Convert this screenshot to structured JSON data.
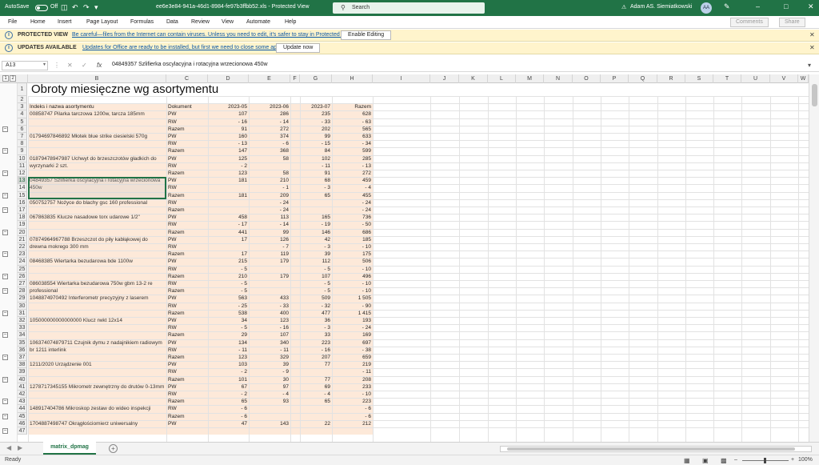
{
  "titlebar": {
    "autosave_label": "AutoSave",
    "autosave_state": "Off",
    "doc_title": "ee6e3e84-941a-46d1-8984-fe97b3ffbb52.xls  -  Protected View",
    "search_placeholder": "Search",
    "user_name": "Adam AS. Siemiatkowski",
    "user_initials": "AA"
  },
  "menu": {
    "items": [
      "File",
      "Home",
      "Insert",
      "Page Layout",
      "Formulas",
      "Data",
      "Review",
      "View",
      "Automate",
      "Help"
    ],
    "comments_label": "Comments",
    "share_label": "Share"
  },
  "protected_bar": {
    "heading": "PROTECTED VIEW",
    "message": "Be careful—files from the Internet can contain viruses. Unless you need to edit, it's safer to stay in Protected View.",
    "button": "Enable Editing"
  },
  "update_bar": {
    "heading": "UPDATES AVAILABLE",
    "message": "Updates for Office are ready to be installed, but first we need to close some apps.",
    "button": "Update now"
  },
  "formula_bar": {
    "name_box": "A13",
    "content": "04849357 Szlifierka oscylacyjna i rotacyjna wrzecionowa 450w"
  },
  "columns": [
    "B",
    "C",
    "D",
    "E",
    "F",
    "G",
    "H",
    "I",
    "J",
    "K",
    "L",
    "M",
    "N",
    "O",
    "P",
    "Q",
    "R",
    "S",
    "T",
    "U",
    "V",
    "W"
  ],
  "selected_cell": "A13",
  "sheet": {
    "title": "Obroty miesięczne wg asortymentu",
    "headers": [
      "Indeks i nazwa asortymentu",
      "Dokument",
      "2023-05",
      "2023-06",
      "2023-07",
      "Razem"
    ],
    "rows": [
      {
        "r": 4,
        "name": "00858747 Pilarka tarczowa 1200w, tarcza 185mm",
        "doc": "PW",
        "v": [
          "107",
          "286",
          "235",
          "628"
        ]
      },
      {
        "r": 5,
        "name": "",
        "doc": "RW",
        "v": [
          "- 16",
          "- 14",
          "- 33",
          "- 63"
        ]
      },
      {
        "r": 6,
        "name": "",
        "doc": "Razem",
        "v": [
          "91",
          "272",
          "202",
          "565"
        ]
      },
      {
        "r": 7,
        "name": "01794697846892 Młotek blue strike ciesielski 570g",
        "doc": "PW",
        "v": [
          "160",
          "374",
          "99",
          "633"
        ]
      },
      {
        "r": 8,
        "name": "",
        "doc": "RW",
        "v": [
          "- 13",
          "- 6",
          "- 15",
          "- 34"
        ]
      },
      {
        "r": 9,
        "name": "",
        "doc": "Razem",
        "v": [
          "147",
          "368",
          "84",
          "599"
        ]
      },
      {
        "r": 10,
        "name": "01879478947987 Uchwyt do brzeszczotów gładkich do wyrzynarki 2 szt.",
        "doc": "PW",
        "v": [
          "125",
          "58",
          "102",
          "285"
        ]
      },
      {
        "r": 11,
        "name": "",
        "doc": "RW",
        "v": [
          "- 2",
          "",
          "- 11",
          "- 13"
        ]
      },
      {
        "r": 12,
        "name": "",
        "doc": "Razem",
        "v": [
          "123",
          "58",
          "91",
          "272"
        ]
      },
      {
        "r": 13,
        "name": "04849357 Szlifierka oscylacyjna i rotacyjna wrzecionowa 450w",
        "doc": "PW",
        "v": [
          "181",
          "210",
          "68",
          "459"
        ]
      },
      {
        "r": 14,
        "name": "",
        "doc": "RW",
        "v": [
          "",
          "- 1",
          "- 3",
          "- 4"
        ]
      },
      {
        "r": 15,
        "name": "",
        "doc": "Razem",
        "v": [
          "181",
          "209",
          "65",
          "455"
        ]
      },
      {
        "r": 16,
        "name": "050752757 Nożyce do blachy gsc 160 professional",
        "doc": "RW",
        "v": [
          "",
          "- 24",
          "",
          "- 24"
        ]
      },
      {
        "r": 17,
        "name": "",
        "doc": "Razem",
        "v": [
          "",
          "- 24",
          "",
          "- 24"
        ]
      },
      {
        "r": 18,
        "name": "067863835 Klucze nasadowe torx udarowe 1/2\"",
        "doc": "PW",
        "v": [
          "458",
          "113",
          "165",
          "736"
        ]
      },
      {
        "r": 19,
        "name": "",
        "doc": "RW",
        "v": [
          "- 17",
          "- 14",
          "- 19",
          "- 50"
        ]
      },
      {
        "r": 20,
        "name": "",
        "doc": "Razem",
        "v": [
          "441",
          "99",
          "146",
          "686"
        ]
      },
      {
        "r": 21,
        "name": "07874964967788 Brzeszczot do piły kabłąkowej do drewna mokrego 300 mm",
        "doc": "PW",
        "v": [
          "17",
          "126",
          "42",
          "185"
        ]
      },
      {
        "r": 22,
        "name": "",
        "doc": "RW",
        "v": [
          "",
          "- 7",
          "- 3",
          "- 10"
        ]
      },
      {
        "r": 23,
        "name": "",
        "doc": "Razem",
        "v": [
          "17",
          "119",
          "39",
          "175"
        ]
      },
      {
        "r": 24,
        "name": "08468385 Wiertarka bezudarowa bde 1100w",
        "doc": "PW",
        "v": [
          "215",
          "179",
          "112",
          "506"
        ]
      },
      {
        "r": 25,
        "name": "",
        "doc": "RW",
        "v": [
          "- 5",
          "",
          "- 5",
          "- 10"
        ]
      },
      {
        "r": 26,
        "name": "",
        "doc": "Razem",
        "v": [
          "210",
          "179",
          "107",
          "496"
        ]
      },
      {
        "r": 27,
        "name": "086038554 Wiertarka bezudarowa 750w gbm 13-2 re professional",
        "doc": "RW",
        "v": [
          "- 5",
          "",
          "- 5",
          "- 10"
        ]
      },
      {
        "r": 28,
        "name": "",
        "doc": "Razem",
        "v": [
          "- 5",
          "",
          "- 5",
          "- 10"
        ]
      },
      {
        "r": 29,
        "name": "1048874970492 Interferometr precyzyjny z laserem",
        "doc": "PW",
        "v": [
          "563",
          "433",
          "509",
          "1 505"
        ]
      },
      {
        "r": 30,
        "name": "",
        "doc": "RW",
        "v": [
          "- 25",
          "- 33",
          "- 32",
          "- 90"
        ]
      },
      {
        "r": 31,
        "name": "",
        "doc": "Razem",
        "v": [
          "538",
          "400",
          "477",
          "1 415"
        ]
      },
      {
        "r": 32,
        "name": "105000000000000000 Klucz rwkt 12x14",
        "doc": "PW",
        "v": [
          "34",
          "123",
          "36",
          "193"
        ]
      },
      {
        "r": 33,
        "name": "",
        "doc": "RW",
        "v": [
          "- 5",
          "- 16",
          "- 3",
          "- 24"
        ]
      },
      {
        "r": 34,
        "name": "",
        "doc": "Razem",
        "v": [
          "29",
          "107",
          "33",
          "169"
        ]
      },
      {
        "r": 35,
        "name": "106374074879711 Czujnik dymu z nadajnikiem radiowym br 1211 interlink",
        "doc": "PW",
        "v": [
          "134",
          "340",
          "223",
          "697"
        ]
      },
      {
        "r": 36,
        "name": "",
        "doc": "RW",
        "v": [
          "- 11",
          "- 11",
          "- 16",
          "- 38"
        ]
      },
      {
        "r": 37,
        "name": "",
        "doc": "Razem",
        "v": [
          "123",
          "329",
          "207",
          "659"
        ]
      },
      {
        "r": 38,
        "name": "1211/2020 Urządzenie 001",
        "doc": "PW",
        "v": [
          "103",
          "39",
          "77",
          "219"
        ]
      },
      {
        "r": 39,
        "name": "",
        "doc": "RW",
        "v": [
          "- 2",
          "- 9",
          "",
          "- 11"
        ]
      },
      {
        "r": 40,
        "name": "",
        "doc": "Razem",
        "v": [
          "101",
          "30",
          "77",
          "208"
        ]
      },
      {
        "r": 41,
        "name": "1278717345155 Mikrometr zewnętrzny do drutów 0-13mm",
        "doc": "PW",
        "v": [
          "67",
          "97",
          "69",
          "233"
        ]
      },
      {
        "r": 42,
        "name": "",
        "doc": "RW",
        "v": [
          "- 2",
          "- 4",
          "- 4",
          "- 10"
        ]
      },
      {
        "r": 43,
        "name": "",
        "doc": "Razem",
        "v": [
          "65",
          "93",
          "65",
          "223"
        ]
      },
      {
        "r": 44,
        "name": "148917404786 Mikroskop zestaw do wideo inspekcji",
        "doc": "RW",
        "v": [
          "- 6",
          "",
          "",
          "- 6"
        ]
      },
      {
        "r": 45,
        "name": "",
        "doc": "Razem",
        "v": [
          "- 6",
          "",
          "",
          "- 6"
        ]
      },
      {
        "r": 46,
        "name": "1704887498747 Okrągłościomierz uniwersalny",
        "doc": "PW",
        "v": [
          "47",
          "143",
          "22",
          "212"
        ]
      }
    ]
  },
  "tabs": {
    "sheet_name": "matrix_dpmag",
    "add_label": "+"
  },
  "status": {
    "ready": "Ready",
    "zoom": "100%"
  },
  "colors": {
    "accent": "#217346",
    "cell_fill": "#fde9d9",
    "text": "#222222"
  }
}
